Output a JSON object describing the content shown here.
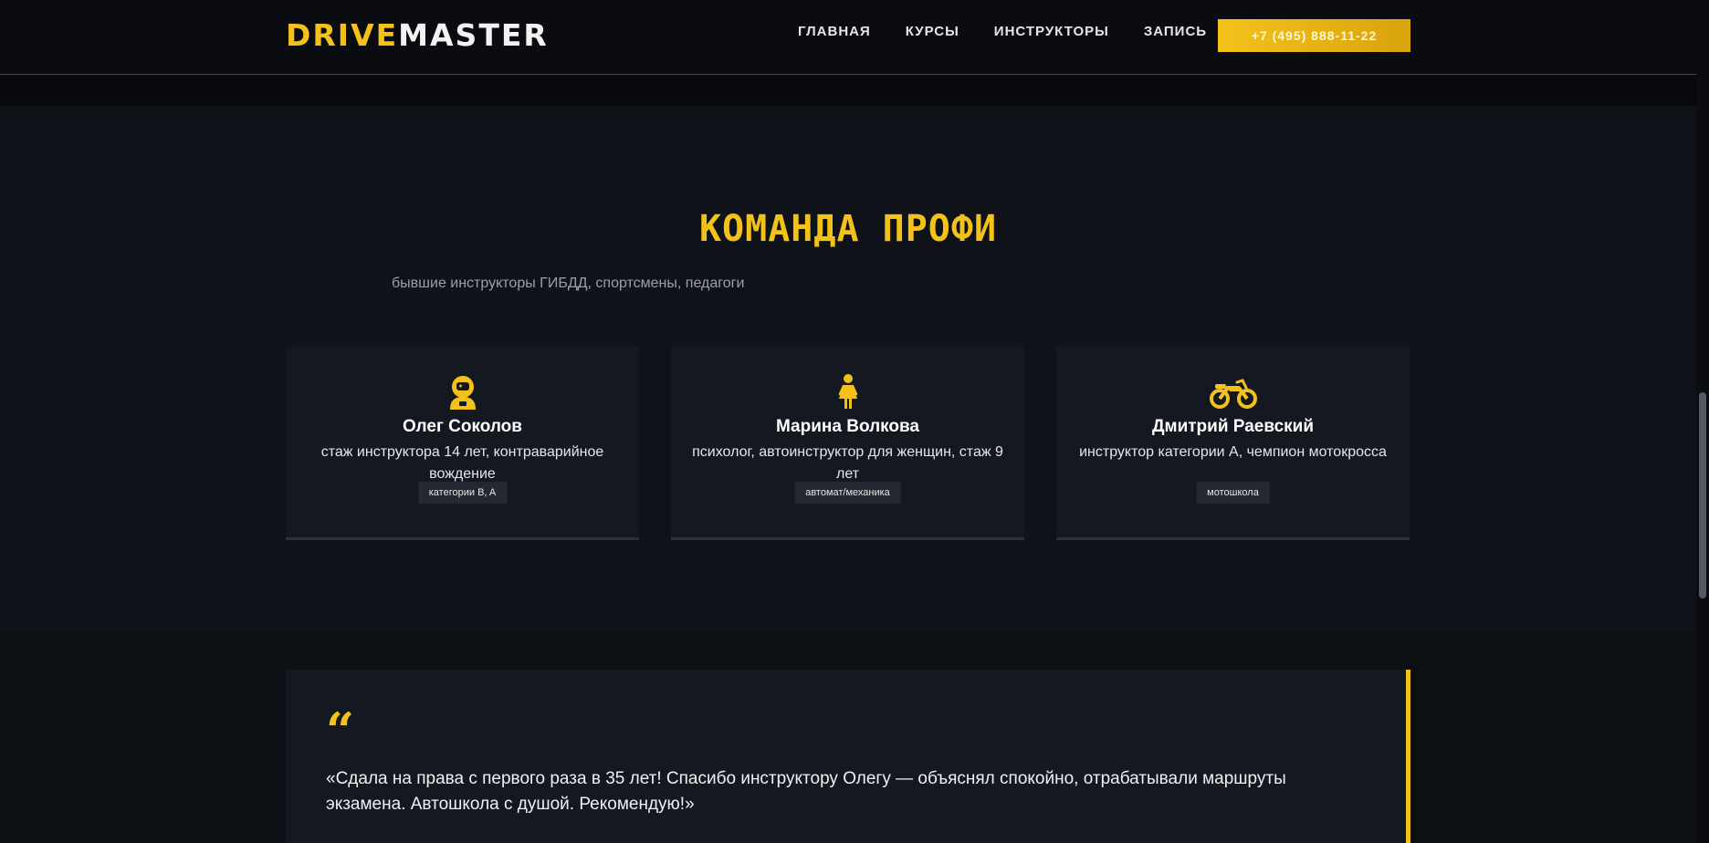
{
  "header": {
    "logo_part1": "DRIVE",
    "logo_part2": "MASTER",
    "nav": [
      "ГЛАВНАЯ",
      "КУРСЫ",
      "ИНСТРУКТОРЫ",
      "ЗАПИСЬ"
    ],
    "phone": "+7 (495) 888-11-22"
  },
  "team": {
    "title": "КОМАНДА ПРОФИ",
    "subtitle": "бывшие инструкторы ГИБДД, спортсмены, педагоги",
    "instructors": [
      {
        "icon": "astronaut-icon",
        "name": "Олег Соколов",
        "desc": "стаж инструктора 14 лет, контраварийное вождение",
        "tag": "категории B, A"
      },
      {
        "icon": "woman-icon",
        "name": "Марина Волкова",
        "desc": "психолог, автоинструктор для женщин, стаж 9 лет",
        "tag": "автомат/механика"
      },
      {
        "icon": "motorcycle-icon",
        "name": "Дмитрий Раевский",
        "desc": "инструктор категории А, чемпион мотокросса",
        "tag": "мотошкола"
      }
    ]
  },
  "testimonial": {
    "quote_mark": "“",
    "text": "«Сдала на права с первого раза в 35 лет! Спасибо инструктору Олегу — объяснял спокойно, отрабатывали маршруты экзамена. Автошкола с душой. Рекомендую!»"
  },
  "colors": {
    "accent": "#f2c21b",
    "background": "#0f1218",
    "card": "#141821"
  }
}
